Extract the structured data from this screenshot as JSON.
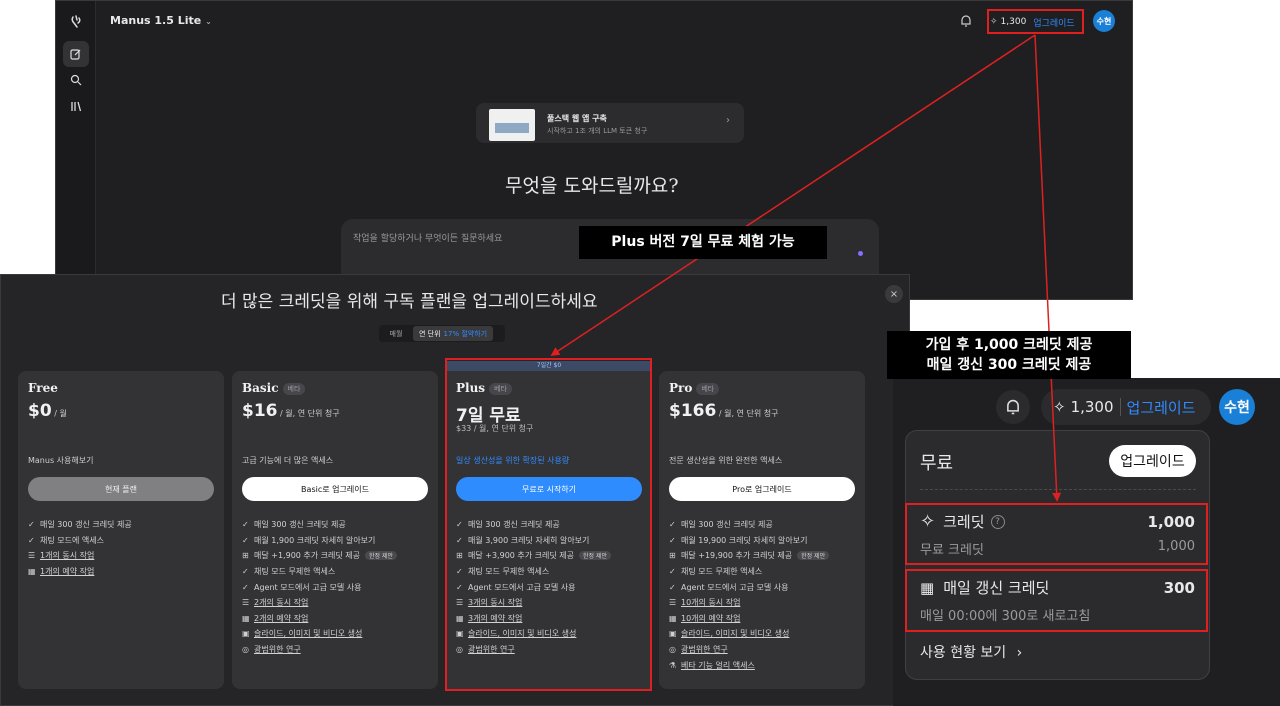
{
  "header": {
    "model": "Manus 1.5 Lite",
    "credits": "1,300",
    "upgrade": "업그레이드",
    "avatar": "수현"
  },
  "main": {
    "promo_title": "풀스택 웹 앱 구축",
    "promo_sub": "시작하고 1조 개의 LLM 토큰 청구",
    "headline": "무엇을 도와드릴까요?",
    "input_placeholder": "작업을 할당하거나 무엇이든 질문하세요"
  },
  "modal": {
    "title": "더 많은 크레딧을 위해 구독 플랜을 업그레이드하세요",
    "toggle_monthly": "매월",
    "toggle_yearly": "연 단위",
    "toggle_discount": "17% 절약하기",
    "plans": [
      {
        "name": "Free",
        "beta": "",
        "price": "$0",
        "price_unit": " / 월",
        "price_sub": "",
        "desc": "Manus 사용해보기",
        "button": "현재 플랜",
        "features": [
          {
            "text": "매일 300 갱신 크레딧 제공",
            "tag": ""
          },
          {
            "text": "채팅 모드에 액세스",
            "tag": ""
          },
          {
            "text": "1개의 동시 작업",
            "tag": ""
          },
          {
            "text": "1개의 예약 작업",
            "tag": ""
          }
        ]
      },
      {
        "name": "Basic",
        "beta": "베타",
        "price": "$16",
        "price_unit": " / 월, 연 단위 청구",
        "price_sub": "",
        "desc": "고급 기능에 더 많은 액세스",
        "button": "Basic로 업그레이드",
        "features": [
          {
            "text": "매일 300 갱신 크레딧 제공",
            "tag": ""
          },
          {
            "text": "매월 1,900 크레딧 자세히 알아보기",
            "tag": ""
          },
          {
            "text": "매달 +1,900 추가 크레딧 제공",
            "tag": "한정 제안"
          },
          {
            "text": "채팅 모드 무제한 액세스",
            "tag": ""
          },
          {
            "text": "Agent 모드에서 고급 모델 사용",
            "tag": ""
          },
          {
            "text": "2개의 동시 작업",
            "tag": ""
          },
          {
            "text": "2개의 예약 작업",
            "tag": ""
          },
          {
            "text": "슬라이드, 이미지 및 비디오 생성",
            "tag": ""
          },
          {
            "text": "광범위한 연구",
            "tag": ""
          }
        ]
      },
      {
        "name": "Plus",
        "beta": "베타",
        "banner": "7일간 $0",
        "price": "7일 무료",
        "price_unit": "",
        "price_sub": "$33 / 월, 연 단위 청구",
        "desc": "일상 생산성을 위한 확장된 사용량",
        "button": "무료로 시작하기",
        "features": [
          {
            "text": "매일 300 갱신 크레딧 제공",
            "tag": ""
          },
          {
            "text": "매월 3,900 크레딧 자세히 알아보기",
            "tag": ""
          },
          {
            "text": "매달 +3,900 추가 크레딧 제공",
            "tag": "한정 제안"
          },
          {
            "text": "채팅 모드 무제한 액세스",
            "tag": ""
          },
          {
            "text": "Agent 모드에서 고급 모델 사용",
            "tag": ""
          },
          {
            "text": "3개의 동시 작업",
            "tag": ""
          },
          {
            "text": "3개의 예약 작업",
            "tag": ""
          },
          {
            "text": "슬라이드, 이미지 및 비디오 생성",
            "tag": ""
          },
          {
            "text": "광범위한 연구",
            "tag": ""
          }
        ]
      },
      {
        "name": "Pro",
        "beta": "베타",
        "price": "$166",
        "price_unit": " / 월, 연 단위 청구",
        "price_sub": "",
        "desc": "전문 생산성을 위한 완전한 액세스",
        "button": "Pro로 업그레이드",
        "features": [
          {
            "text": "매일 300 갱신 크레딧 제공",
            "tag": ""
          },
          {
            "text": "매월 19,900 크레딧 자세히 알아보기",
            "tag": ""
          },
          {
            "text": "매달 +19,900 추가 크레딧 제공",
            "tag": "한정 제안"
          },
          {
            "text": "채팅 모드 무제한 액세스",
            "tag": ""
          },
          {
            "text": "Agent 모드에서 고급 모델 사용",
            "tag": ""
          },
          {
            "text": "10개의 동시 작업",
            "tag": ""
          },
          {
            "text": "10개의 예약 작업",
            "tag": ""
          },
          {
            "text": "슬라이드, 이미지 및 비디오 생성",
            "tag": ""
          },
          {
            "text": "광범위한 연구",
            "tag": ""
          },
          {
            "text": "베타 기능 얼리 액세스",
            "tag": ""
          }
        ]
      }
    ]
  },
  "callouts": {
    "plus_trial": "Plus 버전 7일 무료 체험 가능",
    "credits_line1": "가입 후 1,000 크레딧 제공",
    "credits_line2": "매일 갱신 300 크레딧 제공"
  },
  "zoom": {
    "credits": "1,300",
    "upgrade": "업그레이드",
    "avatar": "수현",
    "plan": "무료",
    "plan_button": "업그레이드",
    "credit_label": "크레딧",
    "credit_value": "1,000",
    "free_credit_label": "무료 크레딧",
    "free_credit_value": "1,000",
    "daily_label": "매일 갱신 크레딧",
    "daily_value": "300",
    "daily_note": "매일 00:00에 300로 새로고침",
    "usage_link": "사용 현황 보기"
  },
  "colors": {
    "accent_blue": "#2f8cff",
    "annotation_red": "#e02020"
  }
}
